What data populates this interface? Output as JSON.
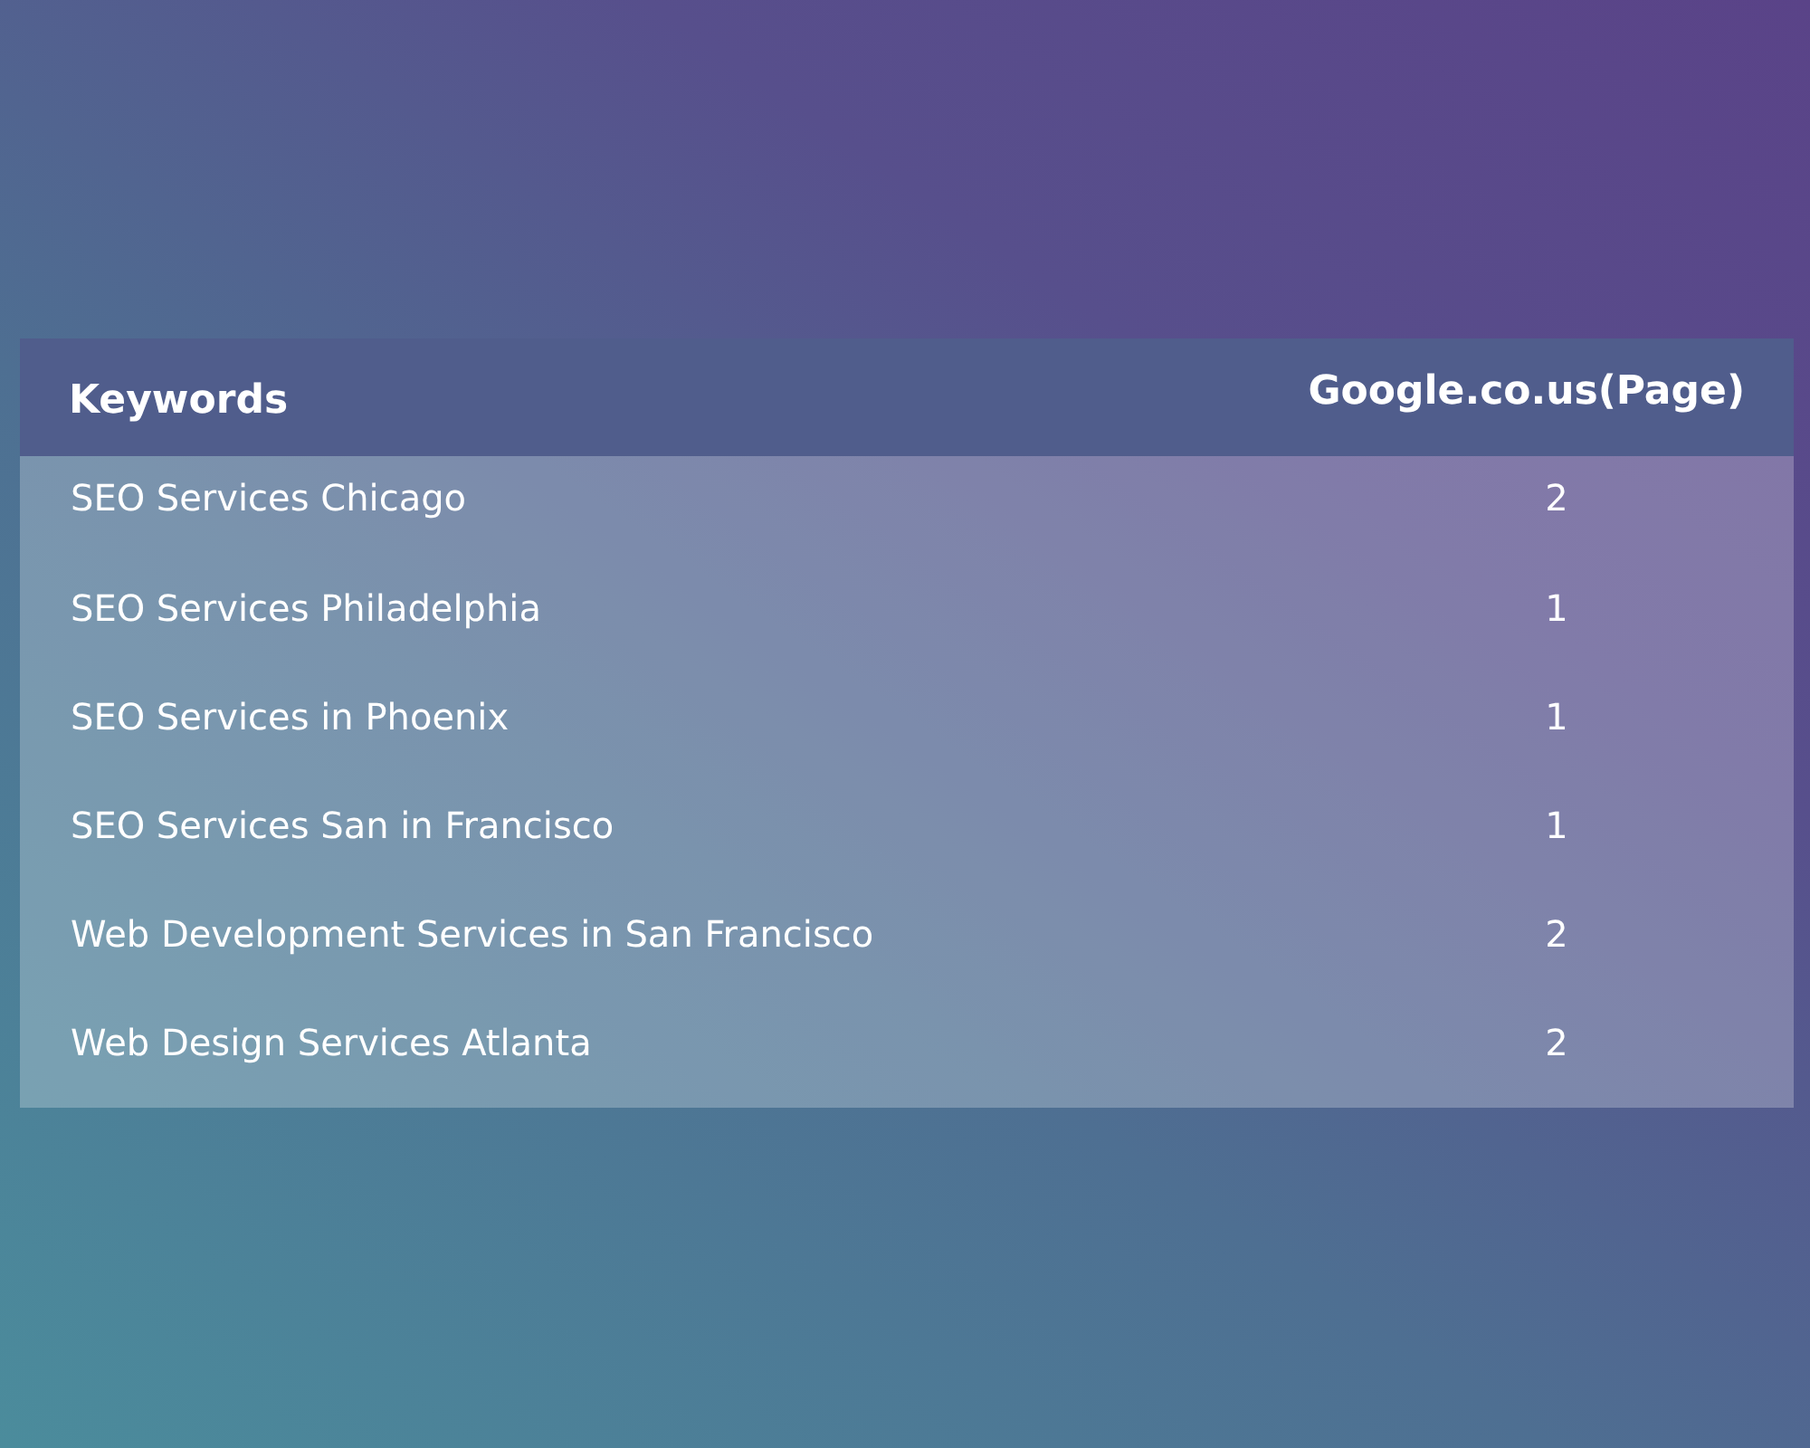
{
  "table": {
    "columns": [
      "Keywords",
      "Google.co.us(Page)"
    ],
    "rows": [
      {
        "keyword": "SEO Services Chicago",
        "page": "2"
      },
      {
        "keyword": "SEO Services Philadelphia",
        "page": "1"
      },
      {
        "keyword": "SEO Services in Phoenix",
        "page": "1"
      },
      {
        "keyword": "SEO Services San in Francisco",
        "page": "1"
      },
      {
        "keyword": "Web Development Services in San Francisco",
        "page": "2"
      },
      {
        "keyword": "Web Design Services Atlanta",
        "page": "2"
      }
    ]
  }
}
